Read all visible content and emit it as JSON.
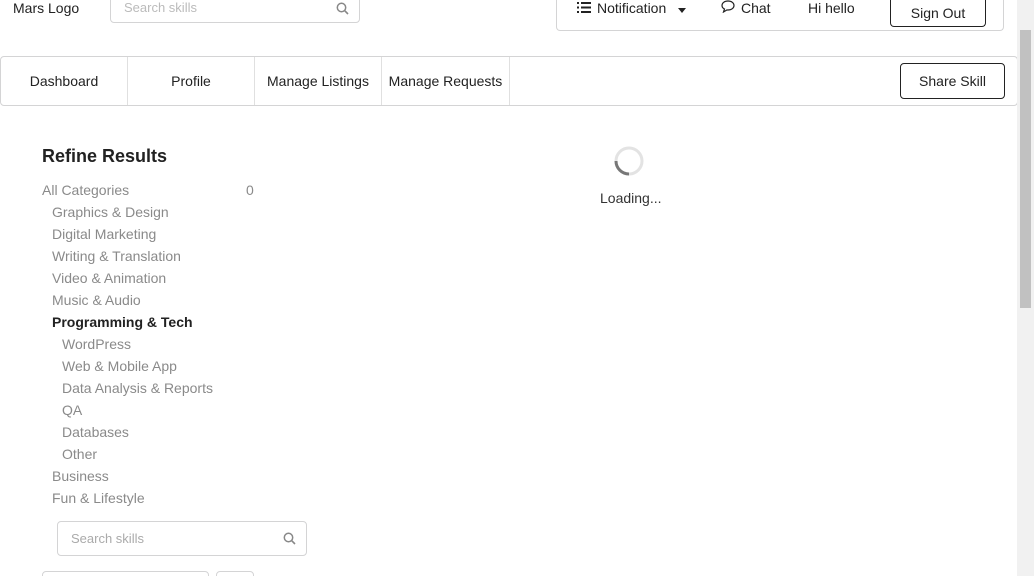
{
  "header": {
    "logo": "Mars Logo",
    "search_placeholder": "Search skills",
    "notification": "Notification",
    "chat": "Chat",
    "greeting": "Hi hello",
    "sign_out": "Sign Out"
  },
  "nav": {
    "dashboard": "Dashboard",
    "profile": "Profile",
    "manage_listings": "Manage Listings",
    "manage_requests": "Manage Requests",
    "share_skill": "Share Skill"
  },
  "refine": {
    "title": "Refine Results",
    "all_categories": "All Categories",
    "all_count": "0",
    "categories": [
      "Graphics & Design",
      "Digital Marketing",
      "Writing & Translation",
      "Video & Animation",
      "Music & Audio",
      "Programming & Tech"
    ],
    "subcategories": [
      "WordPress",
      "Web & Mobile App",
      "Data Analysis & Reports",
      "QA",
      "Databases",
      "Other"
    ],
    "more_categories": [
      "Business",
      "Fun & Lifestyle"
    ],
    "search_placeholder": "Search skills"
  },
  "main": {
    "loading_text": "Loading..."
  },
  "colors": {
    "muted_text": "#8a8a8a",
    "border": "#d4d4d5"
  }
}
